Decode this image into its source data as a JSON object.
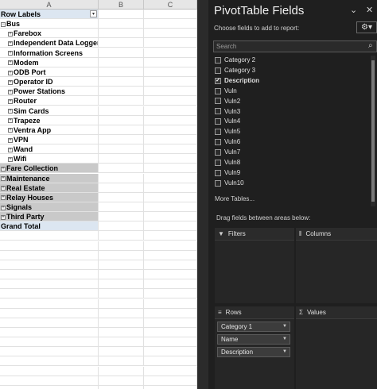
{
  "sheet": {
    "columns": [
      "A",
      "B",
      "C"
    ],
    "header": {
      "label": "Row Labels",
      "filter_icon": "filter-dropdown-icon"
    },
    "bus": {
      "label": "Bus"
    },
    "bus_children": [
      "Farebox",
      "Independent Data Loggers",
      "Information Screens",
      "Modem",
      "ODB Port",
      "Operator ID",
      "Power Stations",
      "Router",
      "Sim Cards",
      "Trapeze",
      "Ventra App",
      "VPN",
      "Wand",
      "Wifi"
    ],
    "groups": [
      "Fare Collection",
      "Maintenance",
      "Real Estate",
      "Relay Houses",
      "Signals",
      "Third Party"
    ],
    "grand_total": "Grand Total"
  },
  "pane": {
    "title": "PivotTable Fields",
    "choose_label": "Choose fields to add to report:",
    "search_placeholder": "Search",
    "fields": [
      {
        "label": "Category 2",
        "checked": false
      },
      {
        "label": "Category 3",
        "checked": false
      },
      {
        "label": "Description",
        "checked": true
      },
      {
        "label": "Vuln",
        "checked": false
      },
      {
        "label": "Vuln2",
        "checked": false
      },
      {
        "label": "Vuln3",
        "checked": false
      },
      {
        "label": "Vuln4",
        "checked": false
      },
      {
        "label": "Vuln5",
        "checked": false
      },
      {
        "label": "Vuln6",
        "checked": false
      },
      {
        "label": "Vuln7",
        "checked": false
      },
      {
        "label": "Vuln8",
        "checked": false
      },
      {
        "label": "Vuln9",
        "checked": false
      },
      {
        "label": "Vuln10",
        "checked": false
      }
    ],
    "more_tables": "More Tables...",
    "drag_title": "Drag fields between areas below:",
    "areas": {
      "filters": "Filters",
      "columns": "Columns",
      "rows": "Rows",
      "values": "Values"
    },
    "row_fields": [
      "Category 1",
      "Name",
      "Description"
    ]
  }
}
